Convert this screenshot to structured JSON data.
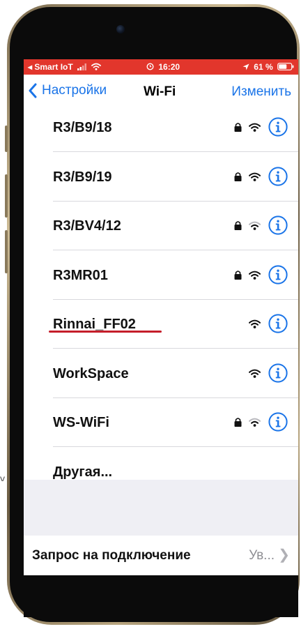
{
  "status_bar": {
    "carrier": "◂ Smart IoT",
    "time": "16:20",
    "battery": "61 %",
    "bg_color": "#e2362c"
  },
  "nav": {
    "back_label": "Настройки",
    "title": "Wi-Fi",
    "edit_label": "Изменить",
    "accent_color": "#1a74e8"
  },
  "networks": [
    {
      "name": "R3/B9/18",
      "locked": true,
      "wifi": "full"
    },
    {
      "name": "R3/B9/19",
      "locked": true,
      "wifi": "full"
    },
    {
      "name": "R3/BV4/12",
      "locked": true,
      "wifi": "weak"
    },
    {
      "name": "R3MR01",
      "locked": true,
      "wifi": "full"
    },
    {
      "name": "Rinnai_FF02",
      "locked": false,
      "wifi": "full",
      "highlighted": true
    },
    {
      "name": "WorkSpace",
      "locked": false,
      "wifi": "full"
    },
    {
      "name": "WS-WiFi",
      "locked": true,
      "wifi": "weak"
    },
    {
      "name": "Другая...",
      "locked": false,
      "wifi": "none"
    }
  ],
  "ask_to_join": {
    "label": "Запрос на подключение",
    "value": "Ув..."
  },
  "icons": {
    "lock": "lock-icon",
    "wifi": "wifi-signal-icon",
    "info": "info-icon",
    "back": "chevron-left-icon",
    "disclosure": "chevron-right-icon"
  }
}
